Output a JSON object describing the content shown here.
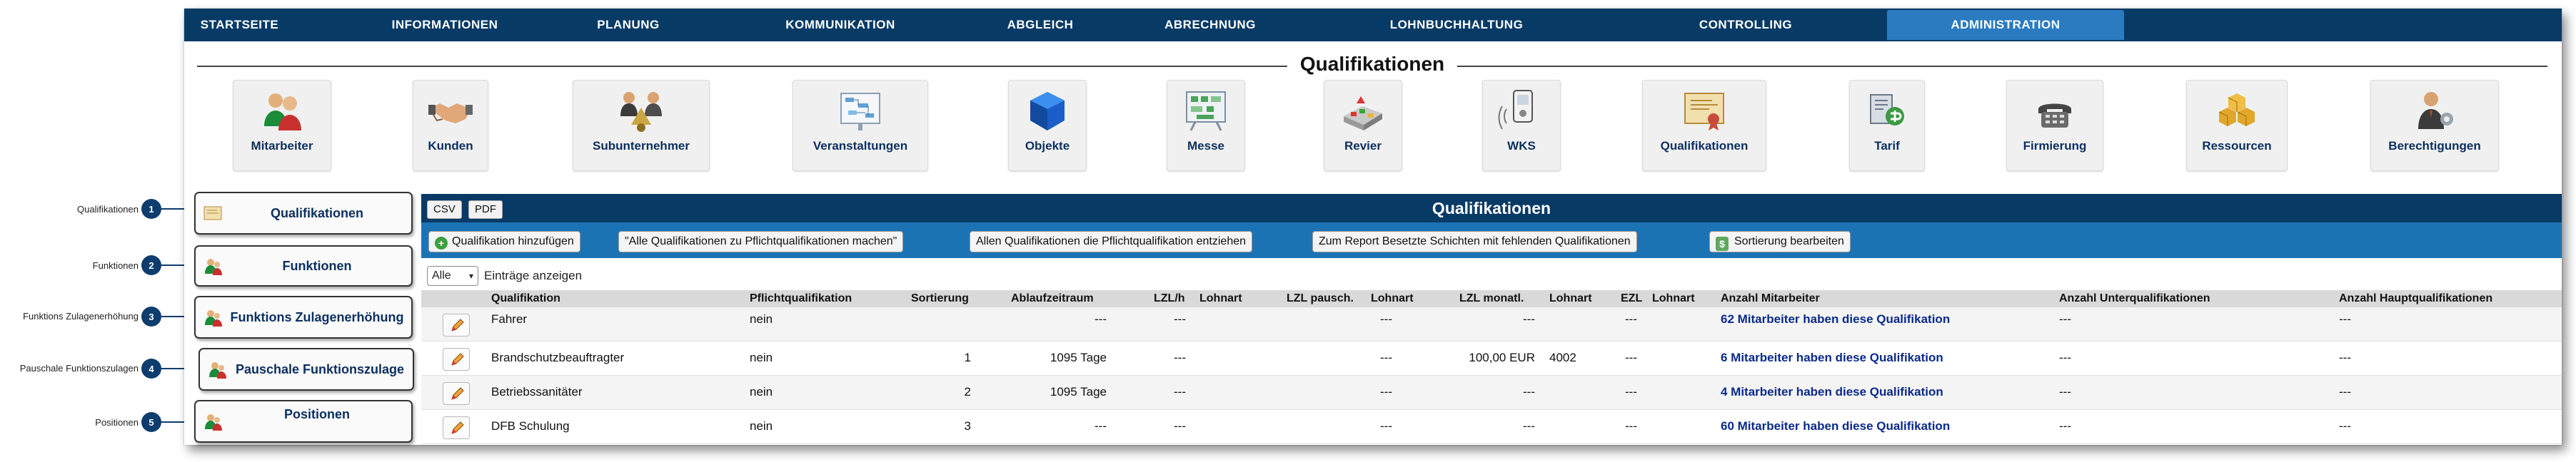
{
  "nav": {
    "items": [
      {
        "label": "STARTSEITE"
      },
      {
        "label": "INFORMATIONEN"
      },
      {
        "label": "PLANUNG"
      },
      {
        "label": "KOMMUNIKATION"
      },
      {
        "label": "ABGLEICH"
      },
      {
        "label": "ABRECHNUNG"
      },
      {
        "label": "LOHNBUCHHALTUNG"
      },
      {
        "label": "CONTROLLING"
      },
      {
        "label": "ADMINISTRATION",
        "active": true
      }
    ],
    "active_color": "#2a7bbf",
    "bar_color": "#083a66"
  },
  "page": {
    "title": "Qualifikationen"
  },
  "modules": [
    {
      "label": "Mitarbeiter",
      "icon": "people-icon"
    },
    {
      "label": "Kunden",
      "icon": "handshake-icon"
    },
    {
      "label": "Subunternehmer",
      "icon": "subcontractor-icon"
    },
    {
      "label": "Veranstaltungen",
      "icon": "event-board-icon"
    },
    {
      "label": "Objekte",
      "icon": "cube-icon"
    },
    {
      "label": "Messe",
      "icon": "exhibition-board-icon"
    },
    {
      "label": "Revier",
      "icon": "district-map-icon"
    },
    {
      "label": "WKS",
      "icon": "device-icon"
    },
    {
      "label": "Qualifikationen",
      "icon": "certificate-icon"
    },
    {
      "label": "Tarif",
      "icon": "tariff-icon"
    },
    {
      "label": "Firmierung",
      "icon": "telephone-icon"
    },
    {
      "label": "Ressourcen",
      "icon": "boxes-icon"
    },
    {
      "label": "Berechtigungen",
      "icon": "user-settings-icon"
    }
  ],
  "annotations": [
    {
      "label": "Qualifikationen",
      "n": "1"
    },
    {
      "label": "Funktionen",
      "n": "2"
    },
    {
      "label": "Funktions Zulagenerhöhung",
      "n": "3"
    },
    {
      "label": "Pauschale Funktionszulagen",
      "n": "4"
    },
    {
      "label": "Positionen",
      "n": "5"
    }
  ],
  "sidemenu": [
    {
      "label": "Qualifikationen",
      "icon": "certificate-icon"
    },
    {
      "label": "Funktionen",
      "icon": "people-icon"
    },
    {
      "label": "Funktions Zulagenerhöhung",
      "icon": "people-icon"
    },
    {
      "label": "Pauschale Funktionszulage",
      "icon": "people-icon"
    },
    {
      "label": "Positionen",
      "icon": "people-icon"
    }
  ],
  "panel": {
    "title": "Qualifikationen",
    "export_buttons": [
      {
        "label": "CSV"
      },
      {
        "label": "PDF"
      }
    ],
    "toolbar": [
      {
        "label": "Qualifikation hinzufügen",
        "icon": "add-icon"
      },
      {
        "label": "\"Alle Qualifikationen zu Pflichtqualifikationen machen\""
      },
      {
        "label": "Allen Qualifikationen die Pflichtqualifikation entziehen"
      },
      {
        "label": "Zum Report Besetzte Schichten mit fehlenden Qualifikationen"
      },
      {
        "label": "Sortierung bearbeiten",
        "icon": "sort-icon"
      }
    ],
    "length_select": {
      "value": "Alle",
      "suffix": "Einträge anzeigen"
    },
    "columns": [
      "Qualifikation",
      "Pflichtqualifikation",
      "Sortierung",
      "Ablaufzeitraum",
      "LZL/h",
      "Lohnart",
      "LZL pausch.",
      "Lohnart",
      "LZL monatl.",
      "Lohnart",
      "EZL",
      "Lohnart",
      "Anzahl Mitarbeiter",
      "Anzahl Unterqualifikationen",
      "Anzahl Hauptqualifikationen"
    ],
    "rows": [
      {
        "name": "Fahrer",
        "pflicht": "nein",
        "sort": "",
        "ablauf": "---",
        "lzlh": "---",
        "lohnart1": "",
        "lzlp": "---",
        "lohnart2": "",
        "lzlm": "---",
        "lohnart3": "",
        "ezl": "---",
        "lohnart4": "",
        "ma": "62 Mitarbeiter haben diese Qualifikation",
        "unter": "---",
        "haupt": "---"
      },
      {
        "name": "Brandschutzbeauftragter",
        "pflicht": "nein",
        "sort": "1",
        "ablauf": "1095 Tage",
        "lzlh": "---",
        "lohnart1": "",
        "lzlp": "---",
        "lohnart2": "",
        "lzlm": "100,00 EUR",
        "lohnart3": "4002",
        "ezl": "---",
        "lohnart4": "",
        "ma": "6 Mitarbeiter haben diese Qualifikation",
        "unter": "---",
        "haupt": "---"
      },
      {
        "name": "Betriebssanitäter",
        "pflicht": "nein",
        "sort": "2",
        "ablauf": "1095 Tage",
        "lzlh": "---",
        "lohnart1": "",
        "lzlp": "---",
        "lohnart2": "",
        "lzlm": "---",
        "lohnart3": "",
        "ezl": "---",
        "lohnart4": "",
        "ma": "4 Mitarbeiter haben diese Qualifikation",
        "unter": "---",
        "haupt": "---"
      },
      {
        "name": "DFB Schulung",
        "pflicht": "nein",
        "sort": "3",
        "ablauf": "---",
        "lzlh": "---",
        "lohnart1": "",
        "lzlp": "---",
        "lohnart2": "",
        "lzlm": "---",
        "lohnart3": "",
        "ezl": "---",
        "lohnart4": "",
        "ma": "60 Mitarbeiter haben diese Qualifikation",
        "unter": "---",
        "haupt": "---"
      }
    ]
  }
}
